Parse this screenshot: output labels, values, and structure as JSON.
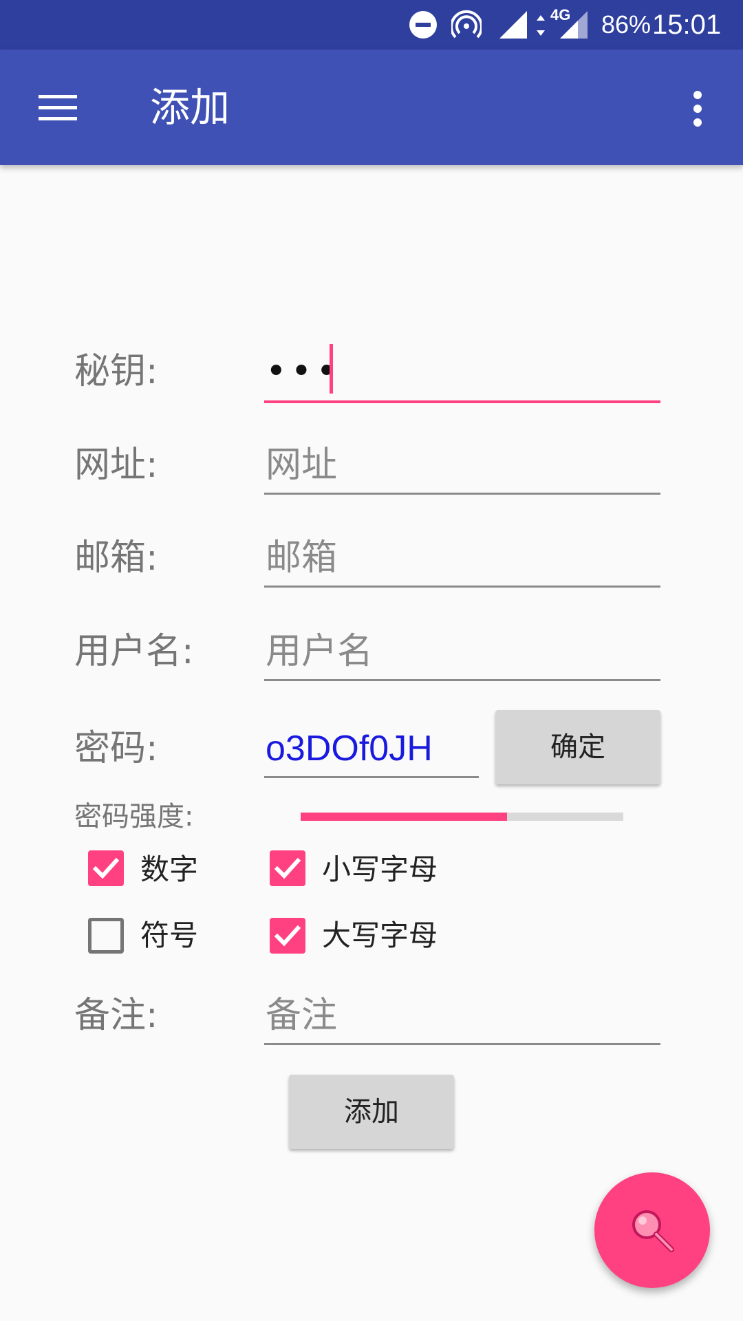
{
  "status_bar": {
    "battery": "86%",
    "time": "15:01",
    "network_label": "4G",
    "icons": [
      "dnd-icon",
      "hotspot-icon",
      "signal-icon",
      "data-arrows-icon",
      "signal-4g-icon"
    ]
  },
  "app_bar": {
    "title": "添加",
    "menu_icon": "hamburger-menu-icon",
    "overflow_icon": "more-vert-icon"
  },
  "form": {
    "secret": {
      "label": "秘钥:",
      "value": "•••"
    },
    "url": {
      "label": "网址:",
      "placeholder": "网址"
    },
    "email": {
      "label": "邮箱:",
      "placeholder": "邮箱"
    },
    "username": {
      "label": "用户名:",
      "placeholder": "用户名"
    },
    "password": {
      "label": "密码:",
      "value": "o3DOf0JH",
      "confirm_label": "确定"
    },
    "strength": {
      "label": "密码强度:",
      "level_percent": 64
    },
    "options": [
      {
        "label": "数字",
        "checked": true
      },
      {
        "label": "小写字母",
        "checked": true
      },
      {
        "label": "符号",
        "checked": false
      },
      {
        "label": "大写字母",
        "checked": true
      }
    ],
    "note": {
      "label": "备注:",
      "placeholder": "备注"
    },
    "submit_label": "添加"
  },
  "fab": {
    "icon": "search-icon"
  },
  "colors": {
    "status_bar": "#2f3f9e",
    "app_bar": "#3f51b5",
    "accent": "#ff4081",
    "password_text": "#1a1adf",
    "background": "#fafafa"
  }
}
